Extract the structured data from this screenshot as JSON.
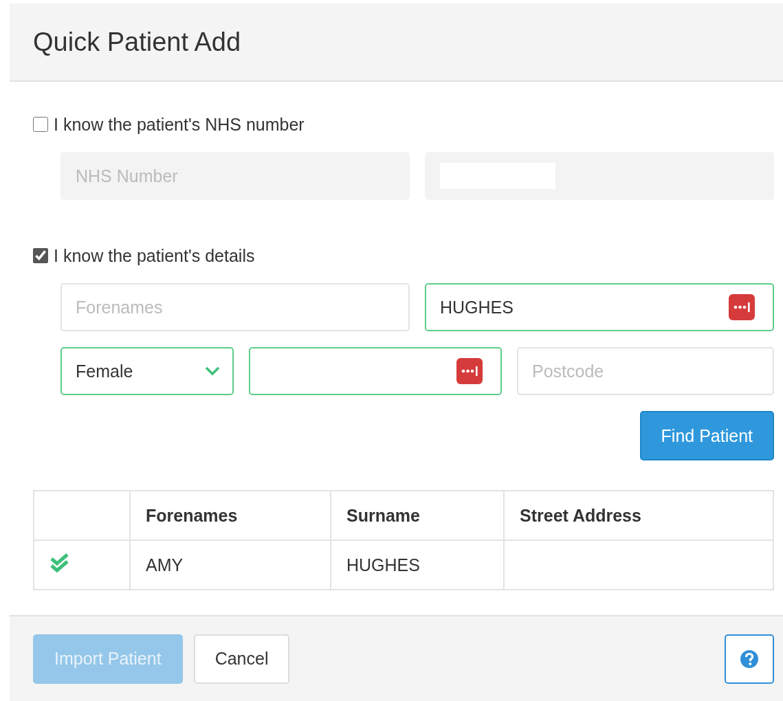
{
  "dialog": {
    "title": "Quick Patient Add"
  },
  "nhs_section": {
    "label": "I know the patient's NHS number",
    "checked": false,
    "fields": [
      {
        "kind": "text",
        "placeholder": "NHS Number",
        "disabled": true
      },
      {
        "kind": "blank",
        "disabled": true
      }
    ]
  },
  "details_section": {
    "label": "I know the patient's details",
    "checked": true,
    "rows": [
      [
        {
          "kind": "text",
          "placeholder": "Forenames",
          "valid": false,
          "disabled": false
        },
        {
          "kind": "text",
          "value": "HUGHES",
          "valid": true,
          "disabled": false,
          "autofill": true
        }
      ],
      [
        {
          "kind": "select",
          "value": "Female",
          "valid": true,
          "disabled": false
        },
        {
          "kind": "text",
          "valid": true,
          "disabled": false,
          "autofill": true
        },
        {
          "kind": "text",
          "placeholder": "Postcode",
          "valid": false,
          "disabled": false
        }
      ]
    ],
    "find_button": "Find Patient"
  },
  "table": {
    "columns": [
      "Forenames",
      "Surname",
      "Street Address"
    ],
    "rows": [
      {
        "matched": true,
        "cells": [
          "AMY",
          "HUGHES"
        ]
      }
    ]
  },
  "footer": {
    "buttons": [
      {
        "label": "Import Patient",
        "kind": "primary",
        "disabled": true
      },
      {
        "label": "Cancel",
        "kind": "default"
      }
    ],
    "help": true
  }
}
